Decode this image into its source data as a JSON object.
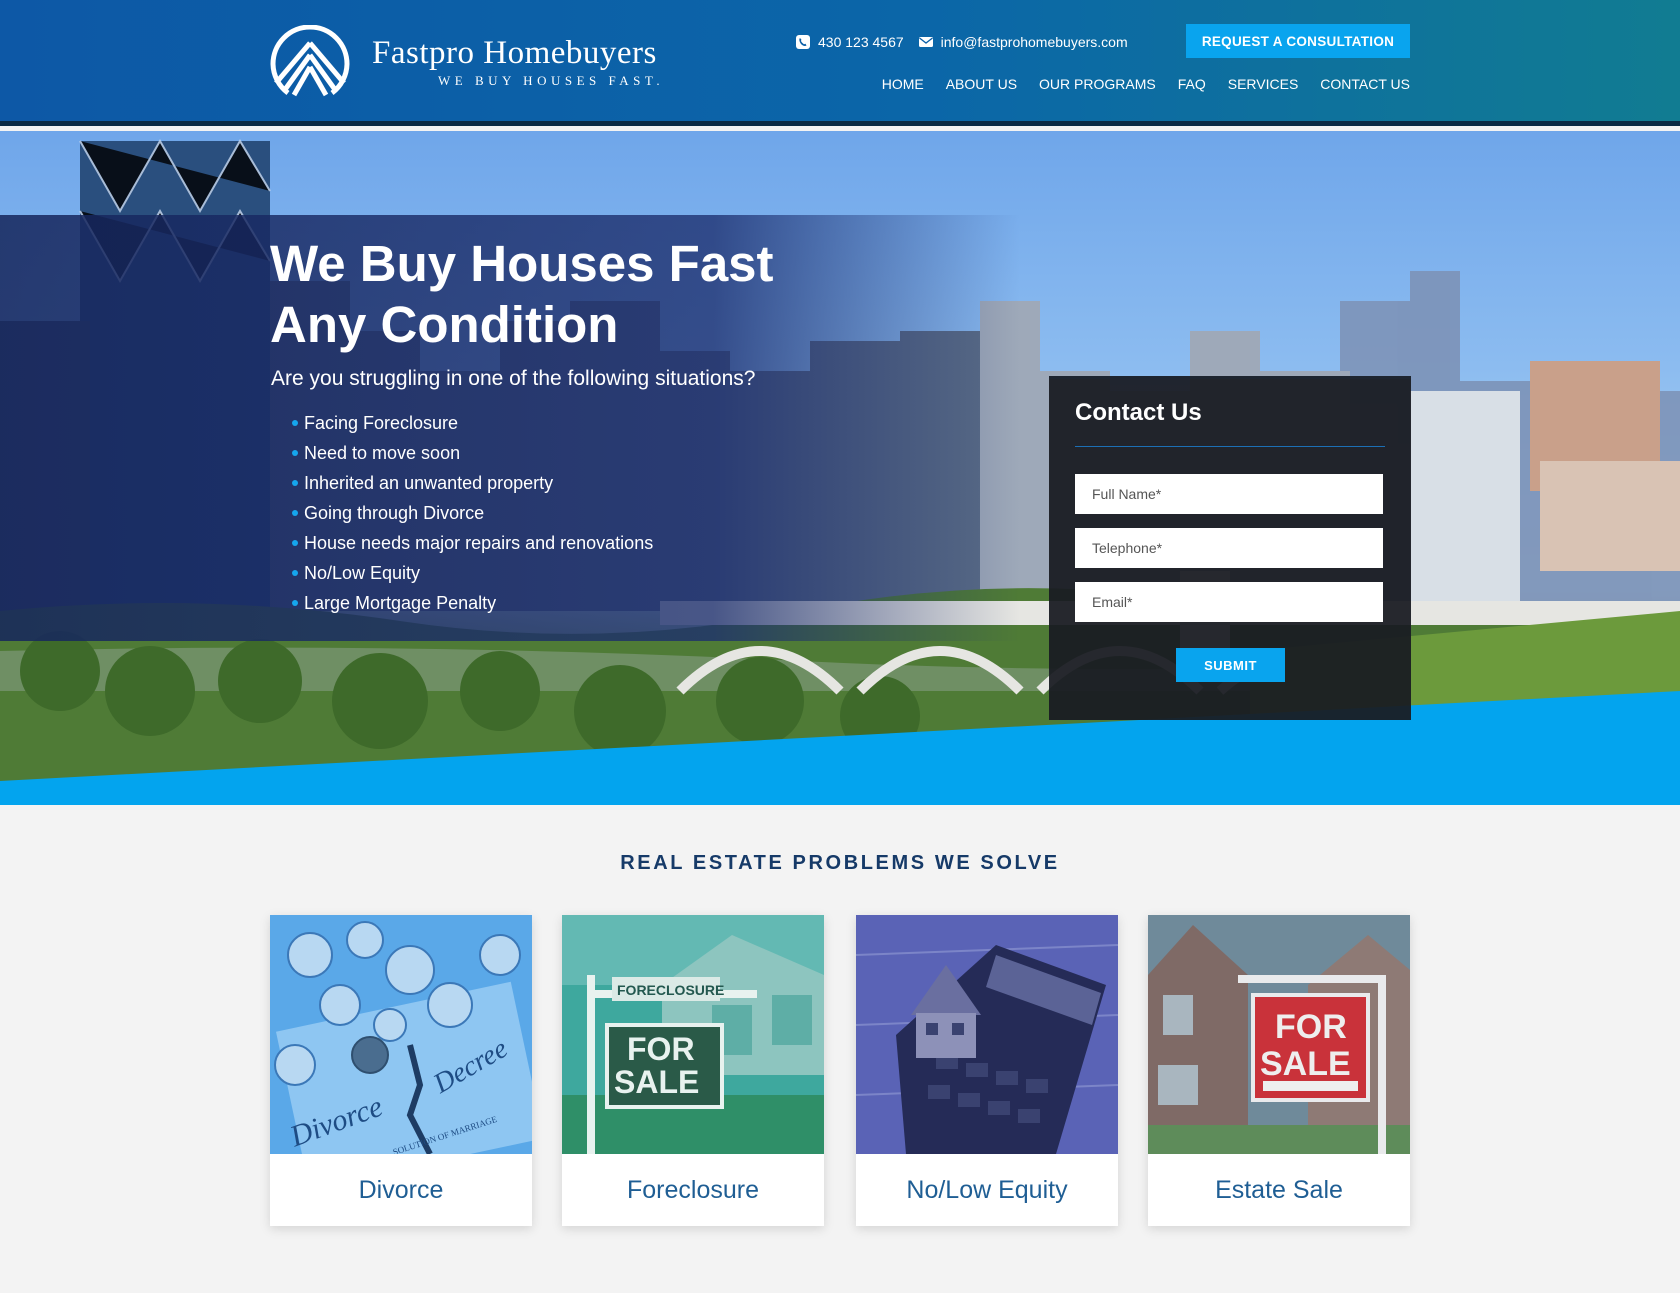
{
  "header": {
    "brand_name": "Fastpro Homebuyers",
    "brand_tagline": "WE BUY HOUSES FAST.",
    "phone": "430 123 4567",
    "email": "info@fastprohomebuyers.com",
    "cta_label": "REQUEST A CONSULTATION",
    "nav": [
      "HOME",
      "ABOUT US",
      "OUR PROGRAMS",
      "FAQ",
      "SERVICES",
      "CONTACT US"
    ]
  },
  "hero": {
    "title_line1": "We Buy Houses Fast",
    "title_line2": "Any Condition",
    "question": "Are you struggling in one of the following situations?",
    "situations": [
      "Facing Foreclosure",
      "Need to move soon",
      "Inherited an unwanted property",
      "Going through Divorce",
      "House needs major repairs and renovations",
      "No/Low Equity",
      "Large Mortgage Penalty"
    ]
  },
  "contact_form": {
    "title": "Contact Us",
    "full_name_placeholder": "Full Name*",
    "telephone_placeholder": "Telephone*",
    "email_placeholder": "Email*",
    "submit_label": "SUBMIT"
  },
  "problems": {
    "title": "REAL ESTATE PROBLEMS WE SOLVE",
    "cards": [
      {
        "label": "Divorce",
        "image_text": [
          "Divorce",
          "Decree",
          "SOLUTION OF MARRIAGE"
        ]
      },
      {
        "label": "Foreclosure",
        "image_text": [
          "FORECLOSURE",
          "FOR",
          "SALE"
        ]
      },
      {
        "label": "No/Low Equity",
        "image_text": []
      },
      {
        "label": "Estate Sale",
        "image_text": [
          "FOR",
          "SALE"
        ]
      }
    ]
  },
  "colors": {
    "accent": "#09a4ee",
    "header_blue": "#0d58a6",
    "header_teal": "#117c92",
    "title_navy": "#163a68",
    "card_label": "#1f5e94"
  },
  "icons": [
    "logo-mark-icon",
    "phone-icon",
    "envelope-icon"
  ]
}
